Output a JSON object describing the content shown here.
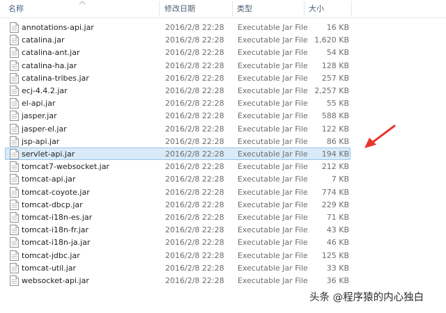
{
  "header": {
    "name": "名称",
    "modified": "修改日期",
    "type": "类型",
    "size": "大小"
  },
  "files": [
    {
      "name": "annotations-api.jar",
      "modified": "2016/2/8 22:28",
      "type": "Executable Jar File",
      "size": "16 KB"
    },
    {
      "name": "catalina.jar",
      "modified": "2016/2/8 22:28",
      "type": "Executable Jar File",
      "size": "1,620 KB"
    },
    {
      "name": "catalina-ant.jar",
      "modified": "2016/2/8 22:28",
      "type": "Executable Jar File",
      "size": "54 KB"
    },
    {
      "name": "catalina-ha.jar",
      "modified": "2016/2/8 22:28",
      "type": "Executable Jar File",
      "size": "128 KB"
    },
    {
      "name": "catalina-tribes.jar",
      "modified": "2016/2/8 22:28",
      "type": "Executable Jar File",
      "size": "257 KB"
    },
    {
      "name": "ecj-4.4.2.jar",
      "modified": "2016/2/8 22:28",
      "type": "Executable Jar File",
      "size": "2,257 KB"
    },
    {
      "name": "el-api.jar",
      "modified": "2016/2/8 22:28",
      "type": "Executable Jar File",
      "size": "55 KB"
    },
    {
      "name": "jasper.jar",
      "modified": "2016/2/8 22:28",
      "type": "Executable Jar File",
      "size": "588 KB"
    },
    {
      "name": "jasper-el.jar",
      "modified": "2016/2/8 22:28",
      "type": "Executable Jar File",
      "size": "122 KB"
    },
    {
      "name": "jsp-api.jar",
      "modified": "2016/2/8 22:28",
      "type": "Executable Jar File",
      "size": "86 KB"
    },
    {
      "name": "servlet-api.jar",
      "modified": "2016/2/8 22:28",
      "type": "Executable Jar File",
      "size": "194 KB",
      "selected": true
    },
    {
      "name": "tomcat7-websocket.jar",
      "modified": "2016/2/8 22:28",
      "type": "Executable Jar File",
      "size": "212 KB"
    },
    {
      "name": "tomcat-api.jar",
      "modified": "2016/2/8 22:28",
      "type": "Executable Jar File",
      "size": "7 KB"
    },
    {
      "name": "tomcat-coyote.jar",
      "modified": "2016/2/8 22:28",
      "type": "Executable Jar File",
      "size": "774 KB"
    },
    {
      "name": "tomcat-dbcp.jar",
      "modified": "2016/2/8 22:28",
      "type": "Executable Jar File",
      "size": "229 KB"
    },
    {
      "name": "tomcat-i18n-es.jar",
      "modified": "2016/2/8 22:28",
      "type": "Executable Jar File",
      "size": "71 KB"
    },
    {
      "name": "tomcat-i18n-fr.jar",
      "modified": "2016/2/8 22:28",
      "type": "Executable Jar File",
      "size": "43 KB"
    },
    {
      "name": "tomcat-i18n-ja.jar",
      "modified": "2016/2/8 22:28",
      "type": "Executable Jar File",
      "size": "46 KB"
    },
    {
      "name": "tomcat-jdbc.jar",
      "modified": "2016/2/8 22:28",
      "type": "Executable Jar File",
      "size": "125 KB"
    },
    {
      "name": "tomcat-util.jar",
      "modified": "2016/2/8 22:28",
      "type": "Executable Jar File",
      "size": "33 KB"
    },
    {
      "name": "websocket-api.jar",
      "modified": "2016/2/8 22:28",
      "type": "Executable Jar File",
      "size": "36 KB"
    }
  ],
  "icons": {
    "file": "jar-file-icon",
    "pointer": "red-arrow-icon"
  },
  "colors": {
    "selection_bg": "#d9ebf9",
    "selection_border": "#98c5ed",
    "header_text": "#4c607a",
    "arrow": "#e8352f"
  },
  "watermark": "头条 @程序猿的内心独白"
}
